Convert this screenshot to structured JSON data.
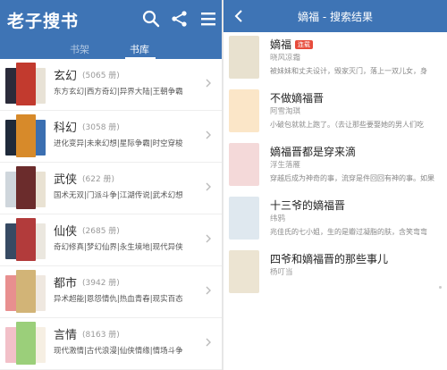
{
  "left": {
    "logo": "老子搜书",
    "tabs": [
      "书架",
      "书库"
    ],
    "active_tab": "书库",
    "categories": [
      {
        "name": "玄幻",
        "count": "(5065 册)",
        "sub": "东方玄幻|西方奇幻|异界大陆|王朝争霸",
        "colors": [
          "#2b2b3a",
          "#c23a2e",
          "#e8e2d6"
        ]
      },
      {
        "name": "科幻",
        "count": "(3058 册)",
        "sub": "进化变异|未来幻想|星际争霸|时空穿梭",
        "colors": [
          "#1f2a3a",
          "#d78a2a",
          "#3b6fb1"
        ]
      },
      {
        "name": "武侠",
        "count": "(622 册)",
        "sub": "国术无双|门派斗争|江湖传说|武术幻想",
        "colors": [
          "#cfd6dc",
          "#6b2c2c",
          "#e9e2d3"
        ]
      },
      {
        "name": "仙侠",
        "count": "(2685 册)",
        "sub": "奇幻修真|梦幻仙界|永生境地|现代异侠",
        "colors": [
          "#374a63",
          "#b23b3b",
          "#ebe7df"
        ]
      },
      {
        "name": "都市",
        "count": "(3942 册)",
        "sub": "异术超能|恩怨情仇|热血青春|现实百态",
        "colors": [
          "#e88f8f",
          "#d2b477",
          "#efe8e0"
        ]
      },
      {
        "name": "言情",
        "count": "(8163 册)",
        "sub": "现代激情|古代浪漫|仙侠情缘|情场斗争",
        "colors": [
          "#f2c0c8",
          "#9bcf7a",
          "#f6efe3"
        ]
      }
    ]
  },
  "right": {
    "title": "嫡福 - 搜索结果",
    "results": [
      {
        "title": "嫡福",
        "badge": "连载",
        "author": "晓风凉霜",
        "desc": "被妹妹和丈夫设计，毁家灭门，落上一双儿女，身",
        "color": "#e8e1cf"
      },
      {
        "title": "不做嫡福晋",
        "badge": "",
        "author": "阿雪淘琪",
        "desc": "小破包就就上跑了。（去让那些要娶她的男人们吃",
        "color": "#fbe6c8"
      },
      {
        "title": "嫡福晋都是穿来滴",
        "badge": "",
        "author": "浮生落雁",
        "desc": "穿越后成为神奇的事，流穿是件回回有神的事。如果",
        "color": "#f4d9d9"
      },
      {
        "title": "十三爷的嫡福晋",
        "badge": "",
        "author": "纬鸦",
        "desc": "兆佳氏的七小姐，生的是瓣过凝脂的肤，含笑弯弯",
        "color": "#dfe8ef"
      },
      {
        "title": "四爷和嫡福晋的那些事儿",
        "badge": "",
        "author": "杨叮当",
        "desc": "",
        "color": "#ece4d2"
      }
    ]
  }
}
